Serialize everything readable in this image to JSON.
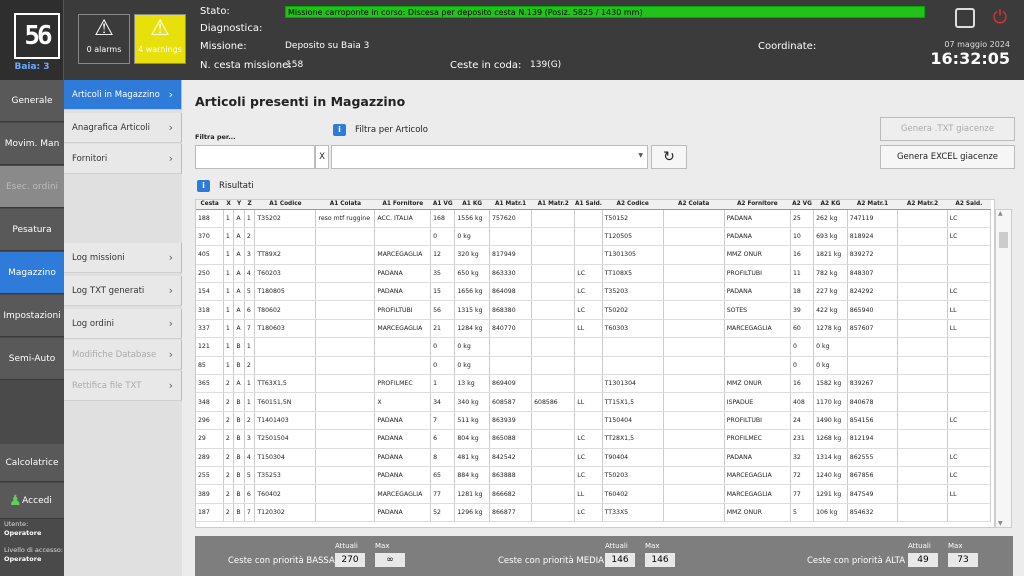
{
  "logo": {
    "text": "56",
    "baia": "Baia: 3"
  },
  "alarms": {
    "alarms_label": "0 alarms",
    "warnings_label": "4 warnings"
  },
  "header": {
    "stato_label": "Stato:",
    "stato_value": "Missione carroponte in corso: Discesa per deposito cesta N.139 (Posiz. 5825 / 1430 mm)",
    "diagnostica_label": "Diagnostica:",
    "missione_label": "Missione:",
    "missione_value": "Deposito su Baia 3",
    "ncesta_label": "N. cesta missione:",
    "ncesta_value": "158",
    "coda_label": "Ceste in coda:",
    "coda_value": "139(G)",
    "coordinate_label": "Coordinate:",
    "date": "07 maggio 2024",
    "time": "16:32:05"
  },
  "sidebar": [
    "Generale",
    "Movim. Man",
    "Esec. ordini",
    "Pesatura",
    "Magazzino",
    "Impostazioni",
    "Semi-Auto",
    "Calcolatrice",
    "Accedi"
  ],
  "user": {
    "utente_label": "Utente:",
    "utente": "Operatore",
    "livello_label": "Livello di accesso:",
    "livello": "Operatore"
  },
  "submenu": [
    "Articoli in Magazzino",
    "Anagrafica Articoli",
    "Fornitori",
    "Log missioni",
    "Log TXT generati",
    "Log ordini",
    "Modifiche Database",
    "Rettifica file TXT"
  ],
  "main": {
    "title": "Articoli presenti in Magazzino",
    "filtra_per": "Filtra per...",
    "filtra_articolo": "Filtra per Articolo",
    "clear": "X",
    "btn_txt": "Genera .TXT giacenze",
    "btn_excel": "Genera EXCEL giacenze",
    "risultati": "Risultati"
  },
  "table": {
    "headers": [
      "Cesta",
      "X",
      "Y",
      "Z",
      "A1 Codice",
      "A1 Colata",
      "A1 Fornitore",
      "A1 VG",
      "A1 KG",
      "A1 Matr.1",
      "A1 Matr.2",
      "A1 Sald.",
      "A2 Codice",
      "A2 Colata",
      "A2 Fornitore",
      "A2 VG",
      "A2 KG",
      "A2 Matr.1",
      "A2 Matr.2",
      "A2 Sald."
    ],
    "rows": [
      [
        "188",
        "1",
        "A",
        "1",
        "T35202",
        "reso mtf ruggine",
        "ACC. ITALIA",
        "168",
        "1556 kg",
        "757620",
        "",
        "",
        "T50152",
        "",
        "PADANA",
        "25",
        "262 kg",
        "747119",
        "",
        "LC"
      ],
      [
        "370",
        "1",
        "A",
        "2",
        "",
        "",
        "",
        "0",
        "0 kg",
        "",
        "",
        "",
        "T120505",
        "",
        "PADANA",
        "10",
        "693 kg",
        "818924",
        "",
        "LC"
      ],
      [
        "405",
        "1",
        "A",
        "3",
        "TT89X2",
        "",
        "MARCEGAGLIA",
        "12",
        "320 kg",
        "817949",
        "",
        "",
        "T1301305",
        "",
        "MMZ ONUR",
        "16",
        "1821 kg",
        "839272",
        "",
        ""
      ],
      [
        "250",
        "1",
        "A",
        "4",
        "T60203",
        "",
        "PADANA",
        "35",
        "650 kg",
        "863330",
        "",
        "LC",
        "TT108X5",
        "",
        "PROFILTUBI",
        "11",
        "782 kg",
        "848307",
        "",
        ""
      ],
      [
        "154",
        "1",
        "A",
        "5",
        "T180805",
        "",
        "PADANA",
        "15",
        "1656 kg",
        "864098",
        "",
        "LC",
        "T35203",
        "",
        "PADANA",
        "18",
        "227 kg",
        "824292",
        "",
        "LC"
      ],
      [
        "318",
        "1",
        "A",
        "6",
        "T80602",
        "",
        "PROFILTUBI",
        "56",
        "1315 kg",
        "868380",
        "",
        "LC",
        "T50202",
        "",
        "SOTES",
        "39",
        "422 kg",
        "865940",
        "",
        "LL"
      ],
      [
        "337",
        "1",
        "A",
        "7",
        "T180603",
        "",
        "MARCEGAGLIA",
        "21",
        "1284 kg",
        "840770",
        "",
        "LL",
        "T60303",
        "",
        "MARCEGAGLIA",
        "60",
        "1278 kg",
        "857607",
        "",
        "LL"
      ],
      [
        "121",
        "1",
        "B",
        "1",
        "",
        "",
        "",
        "0",
        "0 kg",
        "",
        "",
        "",
        "",
        "",
        "",
        "0",
        "0 kg",
        "",
        "",
        ""
      ],
      [
        "85",
        "1",
        "B",
        "2",
        "",
        "",
        "",
        "0",
        "0 kg",
        "",
        "",
        "",
        "",
        "",
        "",
        "0",
        "0 kg",
        "",
        "",
        ""
      ],
      [
        "365",
        "2",
        "A",
        "1",
        "TT63X1,5",
        "",
        "PROFILMEC",
        "1",
        "13 kg",
        "869409",
        "",
        "",
        "T1301304",
        "",
        "MMZ ONUR",
        "16",
        "1582 kg",
        "839267",
        "",
        ""
      ],
      [
        "348",
        "2",
        "B",
        "1",
        "T60151,5N",
        "",
        "X",
        "34",
        "340 kg",
        "608587",
        "608586",
        "LL",
        "TT15X1,5",
        "",
        "ISPADUE",
        "408",
        "1170 kg",
        "840678",
        "",
        ""
      ],
      [
        "296",
        "2",
        "B",
        "2",
        "T1401403",
        "",
        "PADANA",
        "7",
        "511 kg",
        "863939",
        "",
        "",
        "T150404",
        "",
        "PROFILTUBI",
        "24",
        "1490 kg",
        "854156",
        "",
        "LC"
      ],
      [
        "29",
        "2",
        "B",
        "3",
        "T2501504",
        "",
        "PADANA",
        "6",
        "804 kg",
        "865088",
        "",
        "LC",
        "TT28X1,5",
        "",
        "PROFILMEC",
        "231",
        "1268 kg",
        "812194",
        "",
        ""
      ],
      [
        "289",
        "2",
        "B",
        "4",
        "T150304",
        "",
        "PADANA",
        "8",
        "481 kg",
        "842542",
        "",
        "LC",
        "T90404",
        "",
        "PADANA",
        "32",
        "1314 kg",
        "862555",
        "",
        "LC"
      ],
      [
        "255",
        "2",
        "B",
        "5",
        "T35253",
        "",
        "PADANA",
        "65",
        "884 kg",
        "863888",
        "",
        "LC",
        "T50203",
        "",
        "MARCEGAGLIA",
        "72",
        "1240 kg",
        "867856",
        "",
        "LC"
      ],
      [
        "389",
        "2",
        "B",
        "6",
        "T60402",
        "",
        "MARCEGAGLIA",
        "77",
        "1281 kg",
        "866682",
        "",
        "LL",
        "T60402",
        "",
        "MARCEGAGLIA",
        "77",
        "1291 kg",
        "847549",
        "",
        "LL"
      ],
      [
        "187",
        "2",
        "B",
        "7",
        "T120302",
        "",
        "PADANA",
        "52",
        "1296 kg",
        "866877",
        "",
        "LC",
        "TT33X5",
        "",
        "MMZ ONUR",
        "5",
        "106 kg",
        "854632",
        "",
        ""
      ]
    ]
  },
  "footer": {
    "attuali": "Attuali",
    "max": "Max",
    "bassa_label": "Ceste con priorità BASSA",
    "bassa_att": "270",
    "bassa_max": "∞",
    "media_label": "Ceste con priorità MEDIA",
    "media_att": "146",
    "media_max": "146",
    "alta_label": "Ceste con priorità ALTA",
    "alta_att": "49",
    "alta_max": "73"
  }
}
